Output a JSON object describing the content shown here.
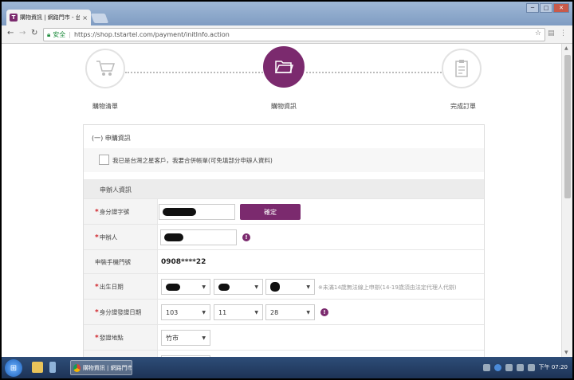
{
  "browser": {
    "tab_title": "購物資訊 | 網路門市 - 台",
    "tab_close": "×",
    "tab_logo": "T",
    "secure_label": "安全",
    "url": "https://shop.tstartel.com/payment/initInfo.action",
    "window_buttons": [
      "─",
      "□",
      "✕"
    ]
  },
  "steps": [
    {
      "label": "購物清單",
      "icon": "cart-icon",
      "active": false
    },
    {
      "label": "購物資訊",
      "icon": "folder-icon",
      "active": true
    },
    {
      "label": "完成訂單",
      "icon": "clipboard-icon",
      "active": false
    }
  ],
  "form": {
    "section_title": "(一) 申購資訊",
    "agree_text": "我已是台灣之星客戶，我要合併帳單(可免填部分申辦人資料)",
    "subheader": "申辦人資訊",
    "fields": {
      "id_number": {
        "label": "身分證字號",
        "required": true,
        "confirm_label": "確定"
      },
      "applicant": {
        "label": "申辦人",
        "required": true
      },
      "phone": {
        "label": "申裝手機門號",
        "required": false,
        "value": "0908****22"
      },
      "birthday": {
        "label": "出生日期",
        "required": true,
        "note": "※未滿14歲無法線上申辦(14-19歲須由法定代理人代辦)"
      },
      "id_issue_date": {
        "label": "身分證發證日期",
        "required": true,
        "year": "103",
        "month": "11",
        "day": "28"
      },
      "issue_place": {
        "label": "發證地點",
        "required": true,
        "value": "竹市"
      }
    },
    "required_mark": "*",
    "info_mark": "!"
  },
  "taskbar": {
    "app_label": "購物資訊 | 網路門市...",
    "clock": "下午 07:20"
  },
  "colors": {
    "brand": "#7b2a6e",
    "required": "#d0282e"
  }
}
